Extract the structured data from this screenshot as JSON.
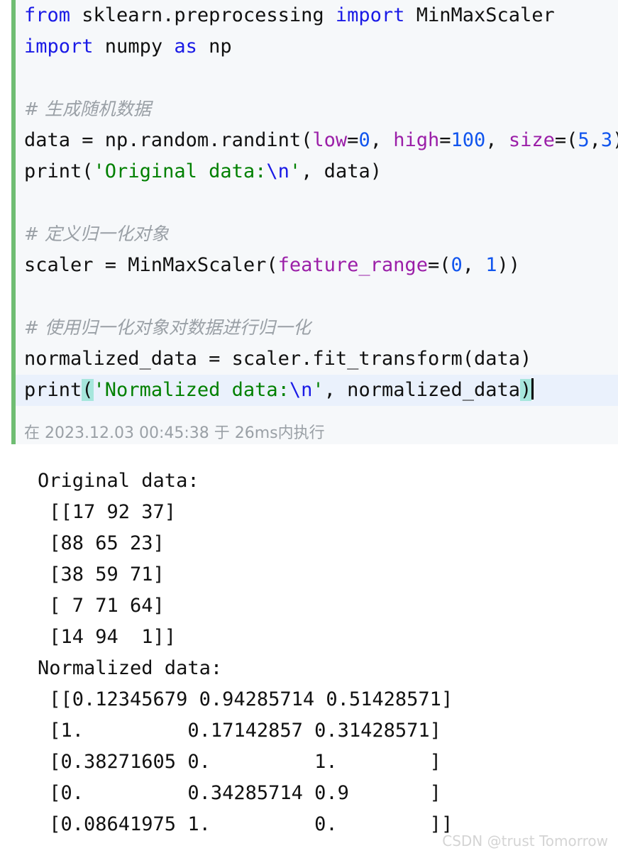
{
  "editor": {
    "language": "python",
    "accent_bar_color": "#6fbd72",
    "background_color": "#f6f8fa",
    "current_line_color": "#eaf1fc",
    "bracket_match_color": "#a6e6dc",
    "lines": [
      {
        "id": "l1",
        "segments": [
          {
            "t": "from",
            "c": "kw"
          },
          {
            "t": " sklearn.preprocessing ",
            "c": "op"
          },
          {
            "t": "import",
            "c": "kw"
          },
          {
            "t": " MinMaxScaler",
            "c": "op"
          }
        ]
      },
      {
        "id": "l2",
        "segments": [
          {
            "t": "import",
            "c": "kw"
          },
          {
            "t": " numpy ",
            "c": "op"
          },
          {
            "t": "as",
            "c": "kw"
          },
          {
            "t": " np",
            "c": "op"
          }
        ]
      },
      {
        "id": "l3",
        "segments": []
      },
      {
        "id": "l4",
        "segments": [
          {
            "t": "# 生成随机数据",
            "c": "cmt"
          }
        ]
      },
      {
        "id": "l5",
        "segments": [
          {
            "t": "data = np.random.randint(",
            "c": "op"
          },
          {
            "t": "low",
            "c": "kwarg"
          },
          {
            "t": "=",
            "c": "op"
          },
          {
            "t": "0",
            "c": "num"
          },
          {
            "t": ", ",
            "c": "op"
          },
          {
            "t": "high",
            "c": "kwarg"
          },
          {
            "t": "=",
            "c": "op"
          },
          {
            "t": "100",
            "c": "num"
          },
          {
            "t": ", ",
            "c": "op"
          },
          {
            "t": "size",
            "c": "kwarg"
          },
          {
            "t": "=(",
            "c": "op"
          },
          {
            "t": "5",
            "c": "num"
          },
          {
            "t": ",",
            "c": "op"
          },
          {
            "t": "3",
            "c": "num"
          },
          {
            "t": "))",
            "c": "op"
          }
        ]
      },
      {
        "id": "l6",
        "segments": [
          {
            "t": "print(",
            "c": "op"
          },
          {
            "t": "'Original data:",
            "c": "str"
          },
          {
            "t": "\\n",
            "c": "esc"
          },
          {
            "t": "'",
            "c": "str"
          },
          {
            "t": ", data)",
            "c": "op"
          }
        ]
      },
      {
        "id": "l7",
        "segments": []
      },
      {
        "id": "l8",
        "segments": [
          {
            "t": "# 定义归一化对象",
            "c": "cmt"
          }
        ]
      },
      {
        "id": "l9",
        "segments": [
          {
            "t": "scaler = MinMaxScaler(",
            "c": "op"
          },
          {
            "t": "feature_range",
            "c": "kwarg"
          },
          {
            "t": "=(",
            "c": "op"
          },
          {
            "t": "0",
            "c": "num"
          },
          {
            "t": ", ",
            "c": "op"
          },
          {
            "t": "1",
            "c": "num"
          },
          {
            "t": "))",
            "c": "op"
          }
        ]
      },
      {
        "id": "l10",
        "segments": []
      },
      {
        "id": "l11",
        "segments": [
          {
            "t": "# 使用归一化对象对数据进行归一化",
            "c": "cmt"
          }
        ]
      },
      {
        "id": "l12",
        "segments": [
          {
            "t": "normalized_data = scaler.fit_transform(data)",
            "c": "op"
          }
        ]
      },
      {
        "id": "l13",
        "current": true,
        "segments": [
          {
            "t": "print",
            "c": "op"
          },
          {
            "t": "(",
            "c": "op brk-hl"
          },
          {
            "t": "'Normalized data:",
            "c": "str"
          },
          {
            "t": "\\n",
            "c": "esc"
          },
          {
            "t": "'",
            "c": "str"
          },
          {
            "t": ", normalized_data",
            "c": "op"
          },
          {
            "t": ")",
            "c": "op brk-hl"
          },
          {
            "t": "",
            "c": "caret"
          }
        ]
      }
    ]
  },
  "execution": {
    "status_text": "在 2023.12.03 00:45:38 于 26ms内执行"
  },
  "output": {
    "lines": [
      "Original data:",
      " [[17 92 37]",
      " [88 65 23]",
      " [38 59 71]",
      " [ 7 71 64]",
      " [14 94  1]]",
      "Normalized data:",
      " [[0.12345679 0.94285714 0.51428571]",
      " [1.         0.17142857 0.31428571]",
      " [0.38271605 0.         1.        ]",
      " [0.         0.34285714 0.9       ]",
      " [0.08641975 1.         0.        ]]"
    ],
    "original_data": [
      [
        17,
        92,
        37
      ],
      [
        88,
        65,
        23
      ],
      [
        38,
        59,
        71
      ],
      [
        7,
        71,
        64
      ],
      [
        14,
        94,
        1
      ]
    ],
    "normalized_data": [
      [
        0.12345679,
        0.94285714,
        0.51428571
      ],
      [
        1.0,
        0.17142857,
        0.31428571
      ],
      [
        0.38271605,
        0.0,
        1.0
      ],
      [
        0.0,
        0.34285714,
        0.9
      ],
      [
        0.08641975,
        1.0,
        0.0
      ]
    ]
  },
  "watermark": {
    "text": "CSDN @trust Tomorrow"
  }
}
